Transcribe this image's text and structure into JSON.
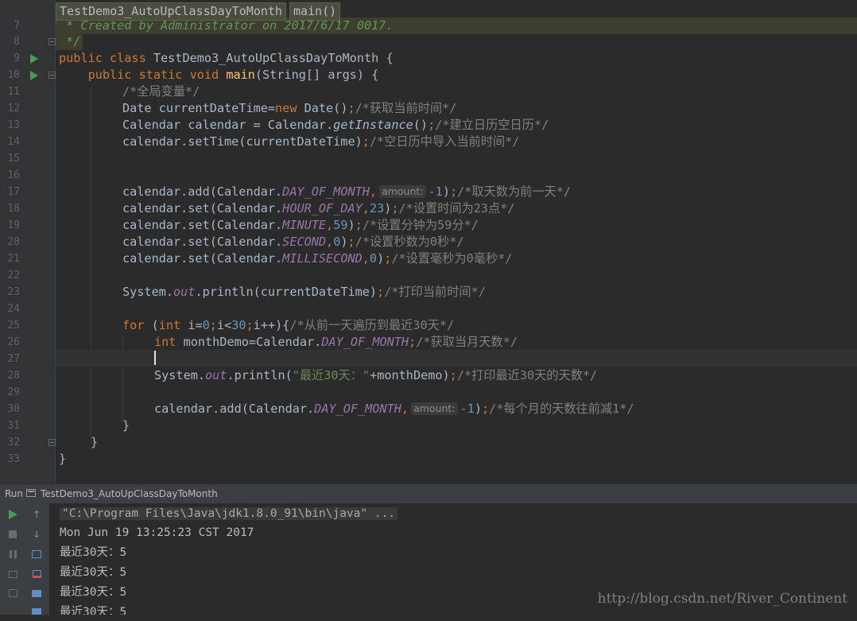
{
  "breadcrumb": {
    "class_name": "TestDemo3_AutoUpClassDayToMonth",
    "method_name": "main()"
  },
  "editor": {
    "line_numbers": [
      "7",
      "8",
      "9",
      "10",
      "11",
      "12",
      "13",
      "14",
      "15",
      "16",
      "17",
      "18",
      "19",
      "20",
      "21",
      "22",
      "23",
      "24",
      "25",
      "26",
      "27",
      "28",
      "29",
      "30",
      "31",
      "32",
      "33"
    ],
    "code": {
      "l7": " * Created by Administrator on 2017/6/17 0017.",
      "l8": " */",
      "l9_kw": "public class ",
      "l9_rest": "TestDemo3_AutoUpClassDayToMonth {",
      "l10_indent": "    ",
      "l10_kw": "public static void ",
      "l10_fn": "main",
      "l10_rest": "(String[] args) {",
      "l11": "/*全局变量*/",
      "l12_a": "Date currentDateTime=",
      "l12_kw": "new ",
      "l12_b": "Date()",
      "l12_semi": ";",
      "l12_cm": "/*获取当前时间*/",
      "l13_a": "Calendar calendar = Calendar.",
      "l13_it": "getInstance",
      "l13_b": "()",
      "l13_semi": ";",
      "l13_cm": "/*建立日历空日历*/",
      "l14_a": "calendar.setTime(currentDateTime)",
      "l14_semi": ";",
      "l14_cm": "/*空日历中导入当前时间*/",
      "l17_a": "calendar.add(Calendar.",
      "l17_sf": "DAY_OF_MONTH",
      "l17_comma": ",",
      "l17_hint": "amount:",
      "l17_num": "-1",
      "l17_b": ")",
      "l17_semi": ";",
      "l17_cm": "/*取天数为前一天*/",
      "l18_a": "calendar.set(Calendar.",
      "l18_sf": "HOUR_OF_DAY",
      "l18_comma": ",",
      "l18_num": "23",
      "l18_b": ")",
      "l18_semi": ";",
      "l18_cm": "/*设置时间为23点*/",
      "l19_a": "calendar.set(Calendar.",
      "l19_sf": "MINUTE",
      "l19_comma": ",",
      "l19_num": "59",
      "l19_b": ")",
      "l19_semi": ";",
      "l19_cm": "/*设置分钟为59分*/",
      "l20_a": "calendar.set(Calendar.",
      "l20_sf": "SECOND",
      "l20_comma": ",",
      "l20_num": "0",
      "l20_b": ")",
      "l20_semi": ";",
      "l20_cm": "/*设置秒数为0秒*/",
      "l21_a": "calendar.set(Calendar.",
      "l21_sf": "MILLISECOND",
      "l21_comma": ",",
      "l21_num": "0",
      "l21_b": ")",
      "l21_semi": ";",
      "l21_cm": "/*设置毫秒为0毫秒*/",
      "l23_a": "System.",
      "l23_sf": "out",
      "l23_b": ".println(currentDateTime)",
      "l23_semi": ";",
      "l23_cm": "/*打印当前时间*/",
      "l25_kw": "for ",
      "l25_a": "(",
      "l25_kw2": "int ",
      "l25_b": "i=",
      "l25_n1": "0",
      "l25_s1": ";",
      "l25_c": "i<",
      "l25_n2": "30",
      "l25_s2": ";",
      "l25_d": "i++){",
      "l25_cm": "/*从前一天遍历到最近30天*/",
      "l26_kw": "int ",
      "l26_a": "monthDemo=Calendar.",
      "l26_sf": "DAY_OF_MONTH",
      "l26_semi": ";",
      "l26_cm": "/*获取当月天数*/",
      "l28_a": "System.",
      "l28_sf": "out",
      "l28_b": ".println(",
      "l28_str": "\"最近30天：\"",
      "l28_c": "+monthDemo)",
      "l28_semi": ";",
      "l28_cm": "/*打印最近30天的天数*/",
      "l30_a": "calendar.add(Calendar.",
      "l30_sf": "DAY_OF_MONTH",
      "l30_comma": ",",
      "l30_hint": "amount:",
      "l30_num": "-1",
      "l30_b": ")",
      "l30_semi": ";",
      "l30_cm": "/*每个月的天数往前减1*/",
      "l31": "}",
      "l32": "}",
      "l33": "}"
    }
  },
  "run_panel": {
    "tab_label": "Run",
    "config_name": "TestDemo3_AutoUpClassDayToMonth",
    "console_lines": [
      "\"C:\\Program Files\\Java\\jdk1.8.0_91\\bin\\java\" ...",
      "Mon Jun 19 13:25:23 CST 2017",
      "最近30天：5",
      "最近30天：5",
      "最近30天：5",
      "最近30天：5"
    ]
  },
  "watermark": "http://blog.csdn.net/River_Continent",
  "colors": {
    "background": "#2b2b2b",
    "keyword": "#cc7832",
    "comment": "#808080",
    "number": "#6897bb",
    "string": "#6a8759",
    "static_field": "#9876aa",
    "method_decl": "#ffc66d"
  }
}
